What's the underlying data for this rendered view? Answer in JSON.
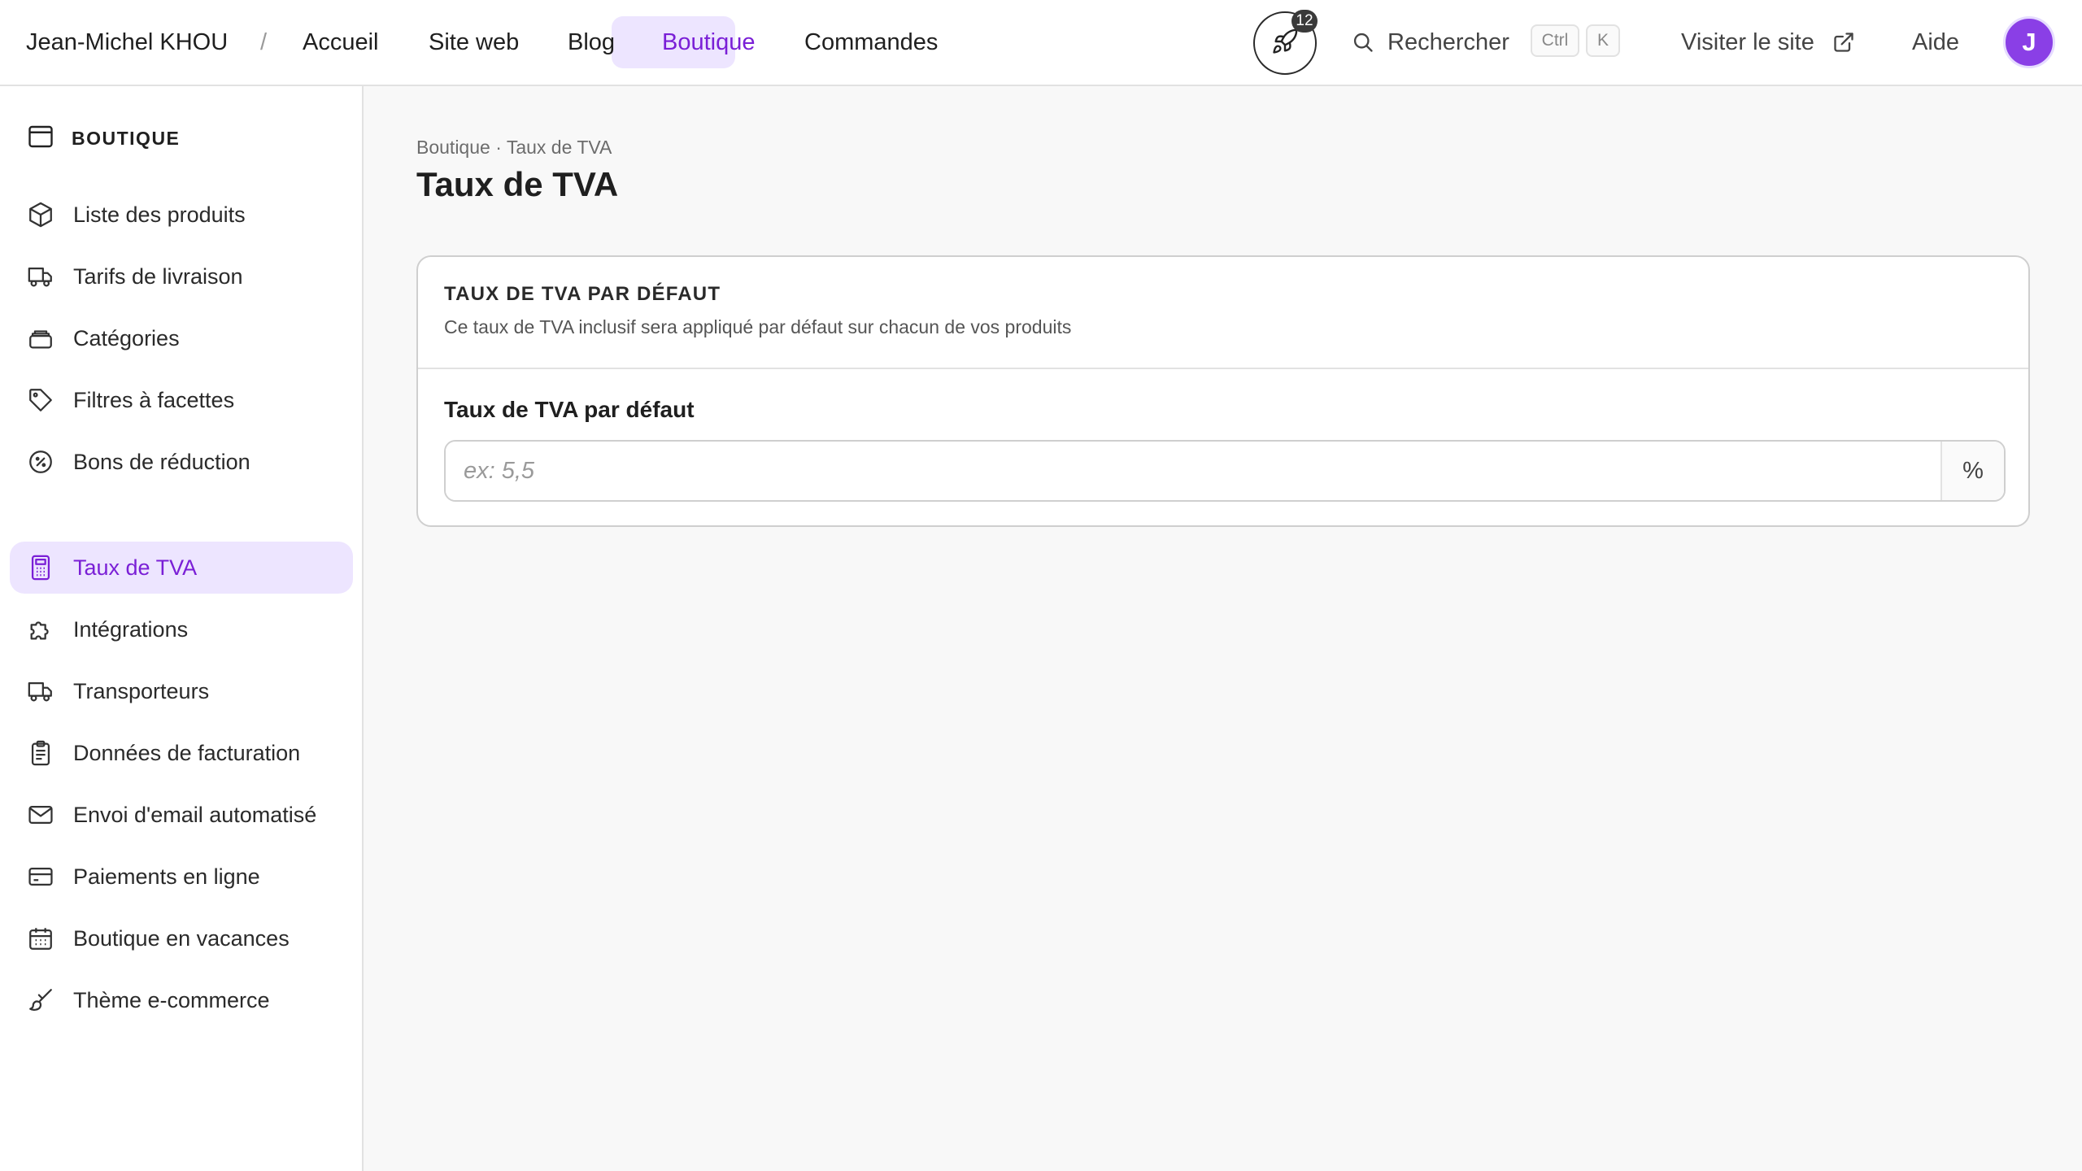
{
  "topbar": {
    "owner_name": "Jean-Michel KHOU",
    "separator": "/",
    "nav": [
      {
        "label": "Accueil"
      },
      {
        "label": "Site web"
      },
      {
        "label": "Blog"
      },
      {
        "label": "Boutique"
      },
      {
        "label": "Commandes"
      }
    ],
    "active_nav": "Boutique",
    "notifications_count": "12",
    "search_label": "Rechercher",
    "shortcut_keys": [
      "Ctrl",
      "K"
    ],
    "visit_site_label": "Visiter le site",
    "help_label": "Aide",
    "avatar_initial": "J"
  },
  "sidebar": {
    "section_title": "BOUTIQUE",
    "items": [
      {
        "label": "Liste des produits",
        "icon": "box-icon"
      },
      {
        "label": "Tarifs de livraison",
        "icon": "truck-icon"
      },
      {
        "label": "Catégories",
        "icon": "stack-icon"
      },
      {
        "label": "Filtres à facettes",
        "icon": "tag-icon"
      },
      {
        "label": "Bons de réduction",
        "icon": "discount-icon"
      },
      {
        "label": "Taux de TVA",
        "icon": "calculator-icon"
      },
      {
        "label": "Intégrations",
        "icon": "puzzle-icon"
      },
      {
        "label": "Transporteurs",
        "icon": "truck-icon"
      },
      {
        "label": "Données de facturation",
        "icon": "clipboard-icon"
      },
      {
        "label": "Envoi d'email automatisé",
        "icon": "mail-icon"
      },
      {
        "label": "Paiements en ligne",
        "icon": "credit-card-icon"
      },
      {
        "label": "Boutique en vacances",
        "icon": "calendar-icon"
      },
      {
        "label": "Thème e-commerce",
        "icon": "brush-icon"
      }
    ],
    "active_item": "Taux de TVA"
  },
  "main": {
    "breadcrumb": "Boutique · Taux de TVA",
    "title": "Taux de TVA",
    "card": {
      "title": "TAUX DE TVA PAR DÉFAUT",
      "description": "Ce taux de TVA inclusif sera appliqué par défaut sur chacun de vos produits",
      "field_label": "Taux de TVA par défaut",
      "field_value": "",
      "field_placeholder": "ex: 5,5",
      "field_suffix": "%"
    }
  },
  "colors": {
    "accent": "#7a1fd6",
    "accent_bg": "#ede5ff",
    "avatar_bg": "#8a3fe6"
  }
}
